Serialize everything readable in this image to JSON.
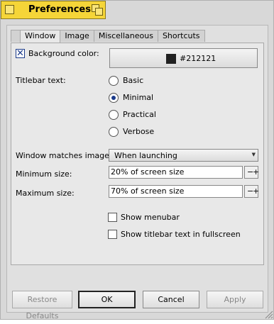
{
  "window": {
    "title": "Preferences"
  },
  "tabs": [
    {
      "label": "Window"
    },
    {
      "label": "Image"
    },
    {
      "label": "Miscellaneous"
    },
    {
      "label": "Shortcuts"
    }
  ],
  "background": {
    "checkbox_label": "Background color:",
    "checked": true,
    "color_value": "#212121"
  },
  "titlebar_text": {
    "label": "Titlebar text:",
    "options": [
      "Basic",
      "Minimal",
      "Practical",
      "Verbose"
    ],
    "selected": "Minimal"
  },
  "matches_image_size": {
    "label": "Window matches image size:",
    "value": "When launching"
  },
  "minimum_size": {
    "label": "Minimum size:",
    "value": "20% of screen size"
  },
  "maximum_size": {
    "label": "Maximum size:",
    "value": "70% of screen size"
  },
  "stepper": {
    "minus": "−",
    "plus": "+"
  },
  "show_menubar": {
    "label": "Show menubar",
    "checked": false
  },
  "show_titlebar_fullscreen": {
    "label": "Show titlebar text in fullscreen",
    "checked": false
  },
  "buttons": {
    "restore_defaults": "Restore Defaults",
    "ok": "OK",
    "cancel": "Cancel",
    "apply": "Apply"
  }
}
